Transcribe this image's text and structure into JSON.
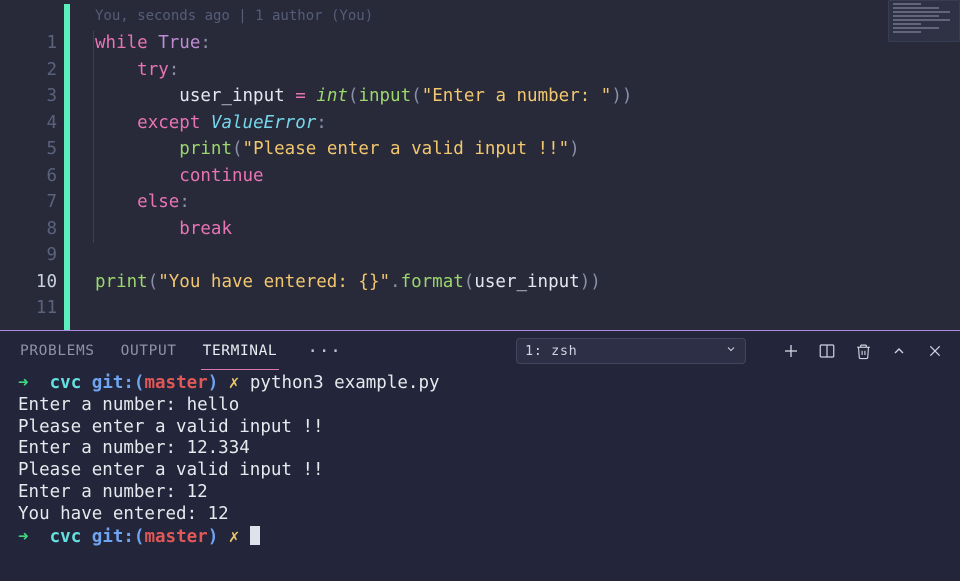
{
  "codelens": "You, seconds ago | 1 author (You)",
  "gutter": [
    "1",
    "2",
    "3",
    "4",
    "5",
    "6",
    "7",
    "8",
    "9",
    "10",
    "11"
  ],
  "code": {
    "l1": {
      "kw": "while",
      "bool": "True",
      "colon": ":"
    },
    "l2": {
      "kw": "try",
      "colon": ":"
    },
    "l3": {
      "var": "user_input",
      "eq": "=",
      "fn": "int",
      "op": "(",
      "call": "input",
      "op2": "(",
      "str": "\"Enter a number: \"",
      "cp": "))"
    },
    "l4": {
      "kw": "except",
      "exc": "ValueError",
      "colon": ":"
    },
    "l5": {
      "call": "print",
      "op": "(",
      "str": "\"Please enter a valid input !!\"",
      "cp": ")"
    },
    "l6": {
      "kw": "continue"
    },
    "l7": {
      "kw": "else",
      "colon": ":"
    },
    "l8": {
      "kw": "break"
    },
    "l10": {
      "call": "print",
      "op": "(",
      "str": "\"You have entered: {}\"",
      "dot": ".",
      "fmt": "format",
      "op2": "(",
      "var": "user_input",
      "cp": "))"
    }
  },
  "panel": {
    "tabs": {
      "problems": "PROBLEMS",
      "output": "OUTPUT",
      "terminal": "TERMINAL"
    },
    "more": "···",
    "select": {
      "label": "1: zsh"
    }
  },
  "terminal": {
    "prompt": {
      "arrow": "➜",
      "dir": "cvc",
      "git_pre": "git:(",
      "branch": "master",
      "git_post": ")",
      "cross": "✗"
    },
    "cmd1": "python3 example.py",
    "lines": [
      "Enter a number: hello",
      "Please enter a valid input !!",
      "Enter a number: 12.334",
      "Please enter a valid input !!",
      "Enter a number: 12",
      "You have entered: 12"
    ]
  }
}
